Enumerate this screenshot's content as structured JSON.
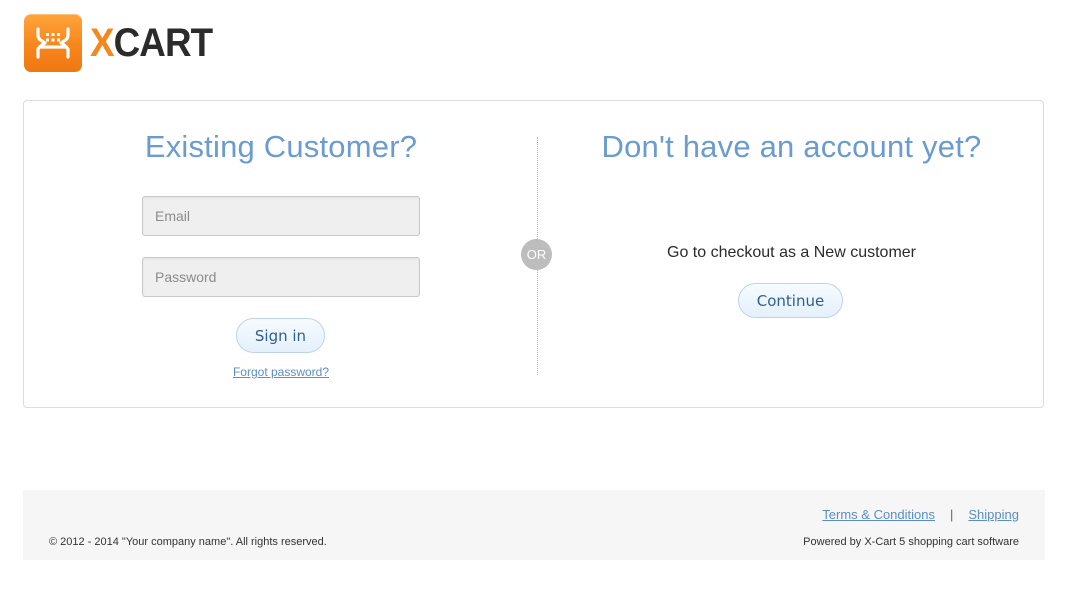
{
  "header": {
    "logo_x": "X",
    "logo_cart": "CART"
  },
  "login": {
    "heading": "Existing Customer?",
    "email_placeholder": "Email",
    "email_value": "",
    "password_placeholder": "Password",
    "password_value": "",
    "signin_label": "Sign in",
    "forgot_label": "Forgot password?"
  },
  "divider": {
    "or_label": "OR"
  },
  "register": {
    "heading": "Don't have an account yet?",
    "checkout_text": "Go to checkout as a New customer",
    "continue_label": "Continue"
  },
  "footer": {
    "links": [
      {
        "label": "Terms & Conditions"
      },
      {
        "label": "Shipping"
      }
    ],
    "separator": "|",
    "copyright": "© 2012 - 2014 \"Your company name\". All rights reserved.",
    "powered": "Powered by X-Cart 5 shopping cart software"
  },
  "colors": {
    "accent": "#f7861c",
    "heading_blue": "#6a9bd1",
    "link_blue": "#5a8ec6"
  },
  "icons": {
    "logo": "cart-icon"
  }
}
